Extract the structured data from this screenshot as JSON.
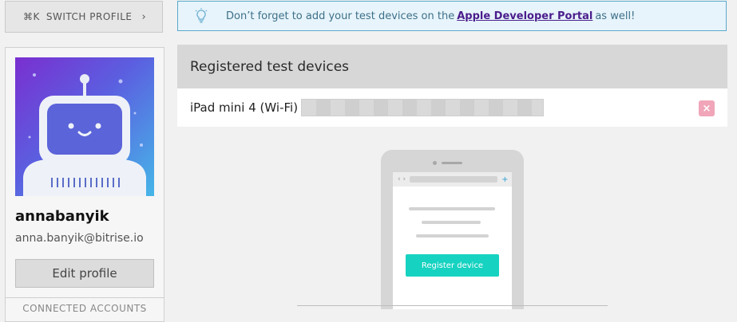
{
  "left": {
    "switch_profile": {
      "shortcut": "⌘K",
      "label": "SWITCH PROFILE",
      "chevron": "›"
    },
    "profile": {
      "username": "annabanyik",
      "email": "anna.banyik@bitrise.io",
      "edit_label": "Edit profile",
      "connected_label": "CONNECTED ACCOUNTS"
    }
  },
  "banner": {
    "text_before": "Don’t forget to add your test devices on the",
    "link": "Apple Developer Portal",
    "text_after": "as well!"
  },
  "devices": {
    "title": "Registered test devices",
    "rows": [
      {
        "name": "iPad mini 4 (Wi-Fi)",
        "delete_icon": "×"
      }
    ]
  },
  "illustration": {
    "nav_arrows": "‹ ›",
    "plus": "+",
    "button_label": "Register device"
  }
}
